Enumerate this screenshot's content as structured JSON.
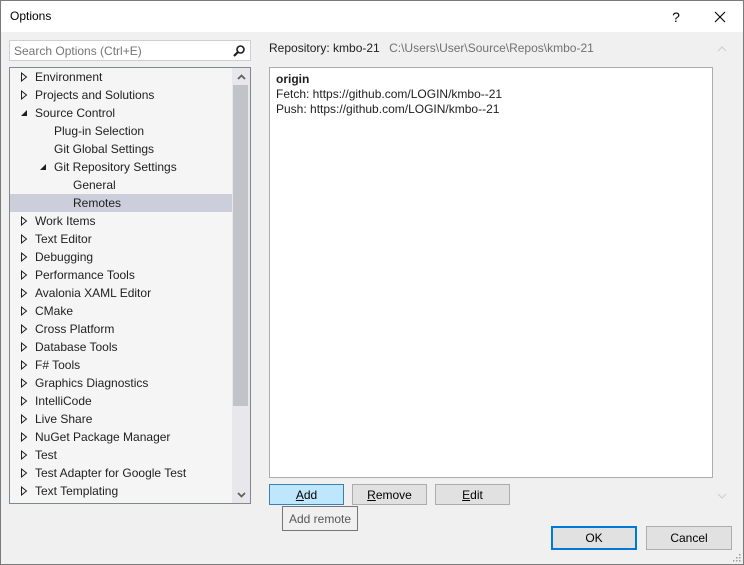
{
  "window": {
    "title": "Options",
    "help_label": "?",
    "close_label": "✕"
  },
  "search": {
    "placeholder": "Search Options (Ctrl+E)",
    "value": ""
  },
  "tree": {
    "items": [
      {
        "label": "Environment",
        "level": 0,
        "expander": "collapsed"
      },
      {
        "label": "Projects and Solutions",
        "level": 0,
        "expander": "collapsed"
      },
      {
        "label": "Source Control",
        "level": 0,
        "expander": "expanded"
      },
      {
        "label": "Plug-in Selection",
        "level": 1,
        "expander": "none"
      },
      {
        "label": "Git Global Settings",
        "level": 1,
        "expander": "none"
      },
      {
        "label": "Git Repository Settings",
        "level": 1,
        "expander": "expanded"
      },
      {
        "label": "General",
        "level": 2,
        "expander": "none"
      },
      {
        "label": "Remotes",
        "level": 2,
        "expander": "none",
        "selected": true
      },
      {
        "label": "Work Items",
        "level": 0,
        "expander": "collapsed"
      },
      {
        "label": "Text Editor",
        "level": 0,
        "expander": "collapsed"
      },
      {
        "label": "Debugging",
        "level": 0,
        "expander": "collapsed"
      },
      {
        "label": "Performance Tools",
        "level": 0,
        "expander": "collapsed"
      },
      {
        "label": "Avalonia XAML Editor",
        "level": 0,
        "expander": "collapsed"
      },
      {
        "label": "CMake",
        "level": 0,
        "expander": "collapsed"
      },
      {
        "label": "Cross Platform",
        "level": 0,
        "expander": "collapsed"
      },
      {
        "label": "Database Tools",
        "level": 0,
        "expander": "collapsed"
      },
      {
        "label": "F# Tools",
        "level": 0,
        "expander": "collapsed"
      },
      {
        "label": "Graphics Diagnostics",
        "level": 0,
        "expander": "collapsed"
      },
      {
        "label": "IntelliCode",
        "level": 0,
        "expander": "collapsed"
      },
      {
        "label": "Live Share",
        "level": 0,
        "expander": "collapsed"
      },
      {
        "label": "NuGet Package Manager",
        "level": 0,
        "expander": "collapsed"
      },
      {
        "label": "Test",
        "level": 0,
        "expander": "collapsed"
      },
      {
        "label": "Test Adapter for Google Test",
        "level": 0,
        "expander": "collapsed"
      },
      {
        "label": "Text Templating",
        "level": 0,
        "expander": "collapsed"
      }
    ],
    "scroll": {
      "position_fraction": 0.0,
      "visible_fraction": 0.8
    }
  },
  "repository": {
    "label": "Repository: kmbo-21",
    "path": "C:\\Users\\User\\Source\\Repos\\kmbo-21"
  },
  "remotes": [
    {
      "name": "origin",
      "fetch": "Fetch: https://github.com/LOGIN/kmbo--21",
      "push": "Push: https://github.com/LOGIN/kmbo--21"
    }
  ],
  "buttons": {
    "add": {
      "mnemonic": "A",
      "rest": "dd"
    },
    "remove": {
      "mnemonic": "R",
      "rest": "emove"
    },
    "edit": {
      "mnemonic": "E",
      "rest": "dit"
    },
    "ok": "OK",
    "cancel": "Cancel"
  },
  "tooltip": "Add remote"
}
